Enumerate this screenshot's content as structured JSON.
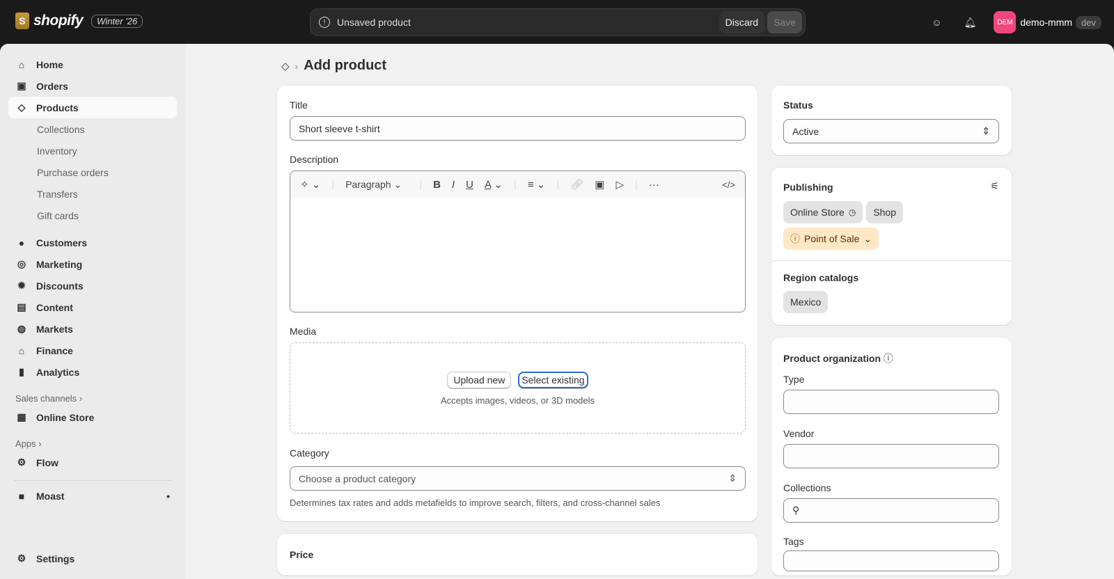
{
  "topbar": {
    "brand": "shopify",
    "logo_letter": "S",
    "release_badge": "Winter '26",
    "unsaved_text": "Unsaved product",
    "discard": "Discard",
    "save": "Save",
    "avatar_initials": "DEM",
    "store_name": "demo-mmm",
    "env_badge": "dev"
  },
  "sidebar": {
    "items": [
      {
        "label": "Home",
        "icon": "home-icon"
      },
      {
        "label": "Orders",
        "icon": "inbox-icon"
      },
      {
        "label": "Products",
        "icon": "tag-icon"
      }
    ],
    "product_sub": [
      "Collections",
      "Inventory",
      "Purchase orders",
      "Transfers",
      "Gift cards"
    ],
    "items2": [
      {
        "label": "Customers"
      },
      {
        "label": "Marketing"
      },
      {
        "label": "Discounts"
      },
      {
        "label": "Content"
      },
      {
        "label": "Markets"
      },
      {
        "label": "Finance"
      },
      {
        "label": "Analytics"
      }
    ],
    "sales_channels": "Sales channels",
    "online_store": "Online Store",
    "apps": "Apps",
    "flow": "Flow",
    "moast": "Moast",
    "settings": "Settings"
  },
  "page": {
    "title": "Add product"
  },
  "form": {
    "title_label": "Title",
    "title_value": "Short sleeve t-shirt",
    "description_label": "Description",
    "paragraph": "Paragraph",
    "media_label": "Media",
    "upload_new": "Upload new",
    "select_existing": "Select existing",
    "media_hint": "Accepts images, videos, or 3D models",
    "category_label": "Category",
    "category_placeholder": "Choose a product category",
    "category_help": "Determines tax rates and adds metafields to improve search, filters, and cross-channel sales",
    "price_label": "Price"
  },
  "status": {
    "label": "Status",
    "value": "Active"
  },
  "publishing": {
    "label": "Publishing",
    "channels": [
      "Online Store",
      "Shop"
    ],
    "pos": "Point of Sale",
    "region_label": "Region catalogs",
    "region": "Mexico"
  },
  "organization": {
    "label": "Product organization",
    "type": "Type",
    "vendor": "Vendor",
    "collections": "Collections",
    "tags": "Tags"
  }
}
